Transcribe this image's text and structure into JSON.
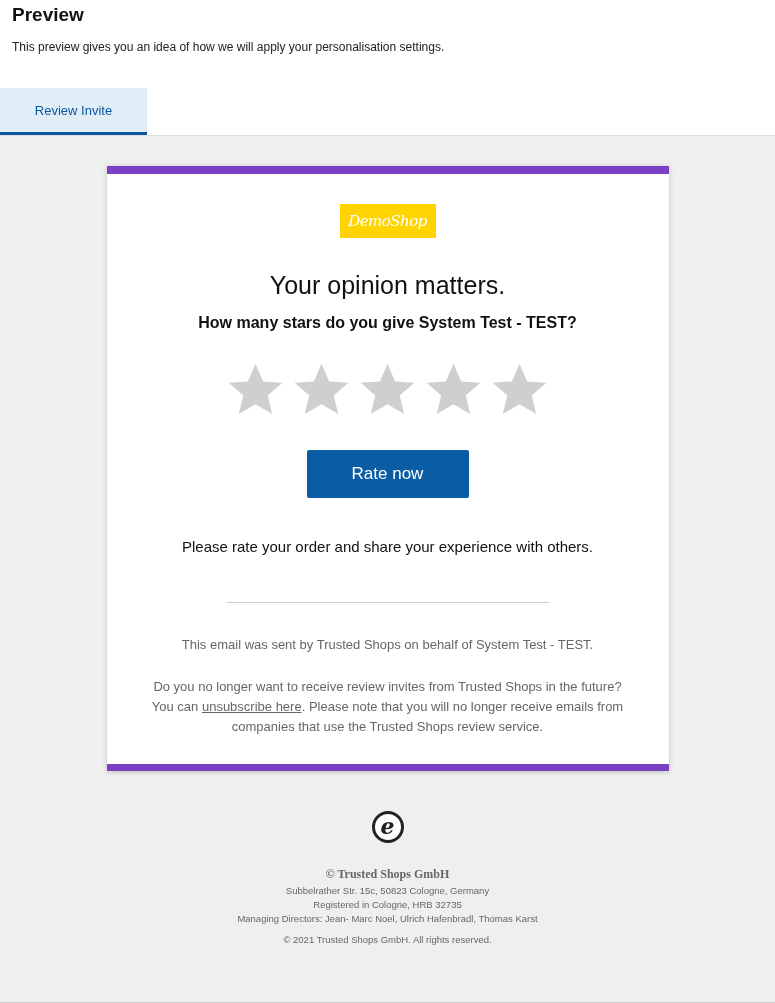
{
  "header": {
    "title": "Preview",
    "description": "This preview gives you an idea of how we will apply your personalisation settings."
  },
  "tabs": [
    {
      "label": "Review Invite",
      "selected": true
    }
  ],
  "email": {
    "logo": "DemoShop",
    "heading": "Your opinion matters.",
    "question": "How many stars do you give System Test - TEST?",
    "rating": {
      "stars": 0
    },
    "button": "Rate now",
    "prompt": "Please rate your order and share your experience with others.",
    "sender_note": "This email was sent by Trusted Shops on behalf of System Test - TEST.",
    "unsubscribe": {
      "before": "Do you no longer want to receive review invites from Trusted Shops in the future? You can",
      "link": "unsubscribe here",
      "after": ". Please note that you will no longer receive emails from companies that use the Trusted Shops review service."
    }
  },
  "footer": {
    "trustmark": "e",
    "company": "© Trusted Shops GmbH",
    "lines": [
      "Subbelrather Str. 15c, 50823 Cologne, Germany",
      "Registered in Cologne, HRB 32735",
      "Managing Directors: Jean- Marc Noel, Ulrich Hafenbradl, Thomas Karst"
    ],
    "copyright": "© 2021 Trusted Shops GmbH. All rights reserved."
  }
}
